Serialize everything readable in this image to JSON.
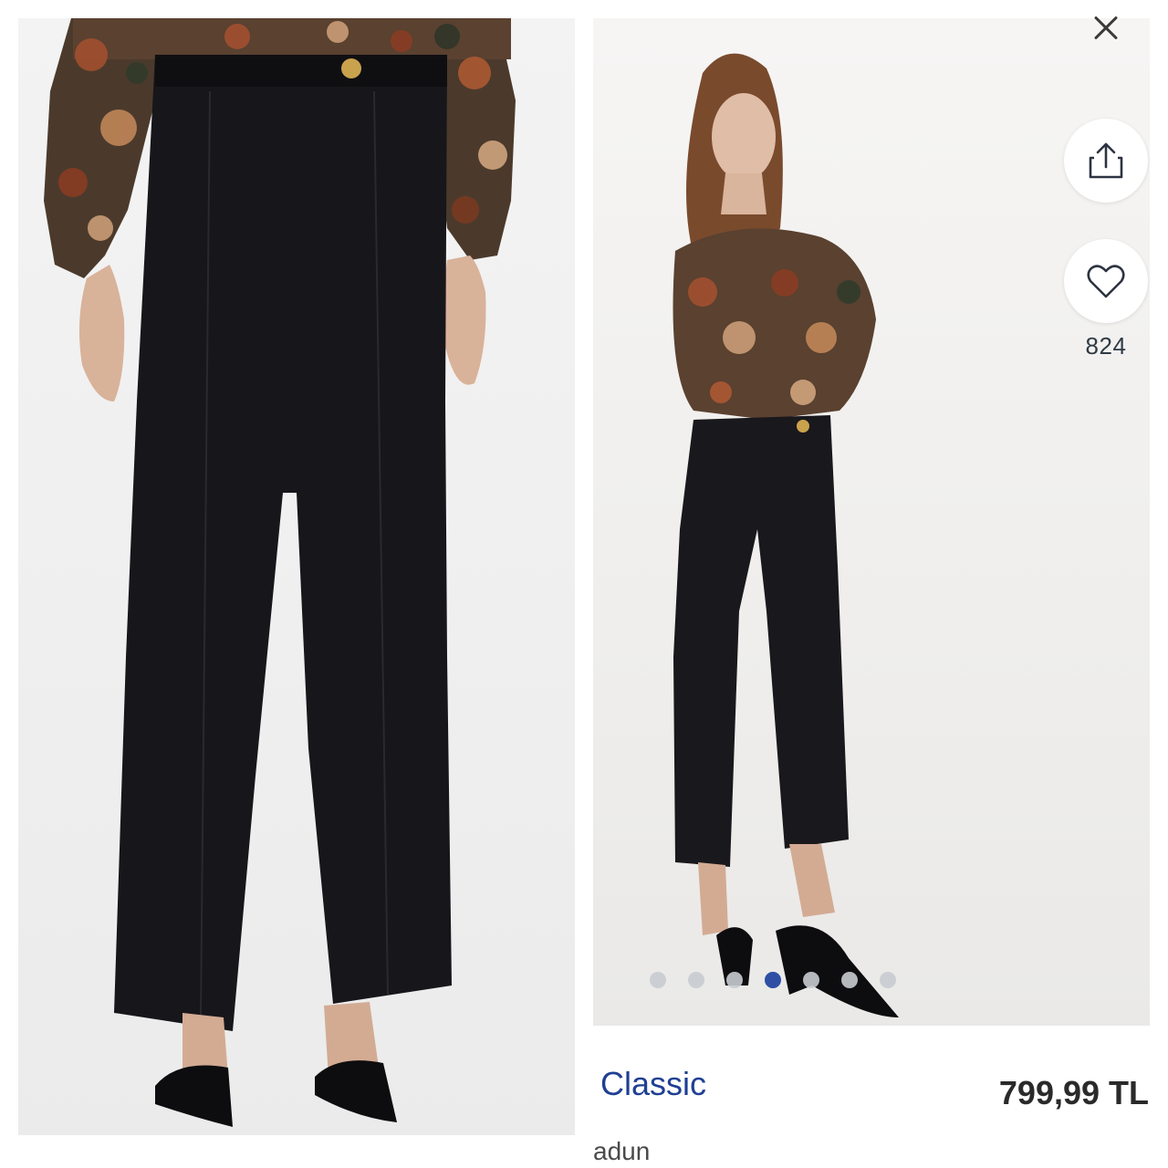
{
  "left_image": {
    "alt": ""
  },
  "right_image": {
    "alt": ""
  },
  "gallery": {
    "favorite_count": "824",
    "dots": [
      false,
      false,
      false,
      true,
      false,
      false,
      false
    ]
  },
  "product": {
    "name": "Classic",
    "price": "799,99 TL",
    "cut_text": "adun"
  },
  "icons": {
    "close": "close-icon",
    "share": "share-icon",
    "heart": "heart-icon"
  },
  "colors": {
    "accent": "#1f3f93",
    "dot_active": "#1a3e9c",
    "dot_inactive": "#c8ccd0",
    "price": "#2a2a2a"
  }
}
